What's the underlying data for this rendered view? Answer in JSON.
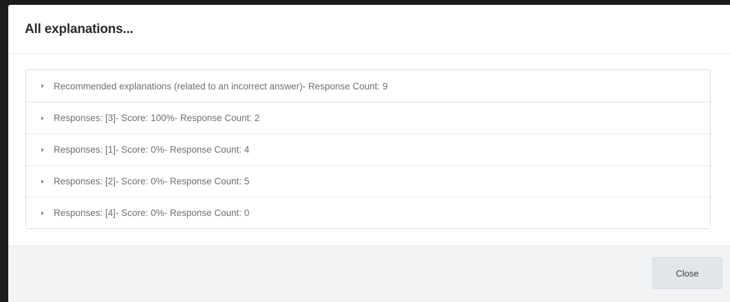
{
  "modal": {
    "title": "All explanations...",
    "close_label": "Close"
  },
  "accordion": {
    "items": [
      {
        "label": "Recommended explanations (related to an incorrect answer)- Response Count: 9",
        "icon": "caret-right-icon"
      },
      {
        "label": "Responses: [3]- Score: 100%- Response Count: 2",
        "icon": "caret-right-icon"
      },
      {
        "label": "Responses: [1]- Score: 0%- Response Count: 4",
        "icon": "caret-right-icon"
      },
      {
        "label": "Responses: [2]- Score: 0%- Response Count: 5",
        "icon": "caret-right-icon"
      },
      {
        "label": "Responses: [4]- Score: 0%- Response Count: 0",
        "icon": "caret-right-icon"
      }
    ]
  },
  "colors": {
    "backdrop": "#1b1b1b",
    "footer_bg": "#f1f3f5",
    "button_bg": "#e3e6e9",
    "label_text": "#6e6e6e"
  }
}
